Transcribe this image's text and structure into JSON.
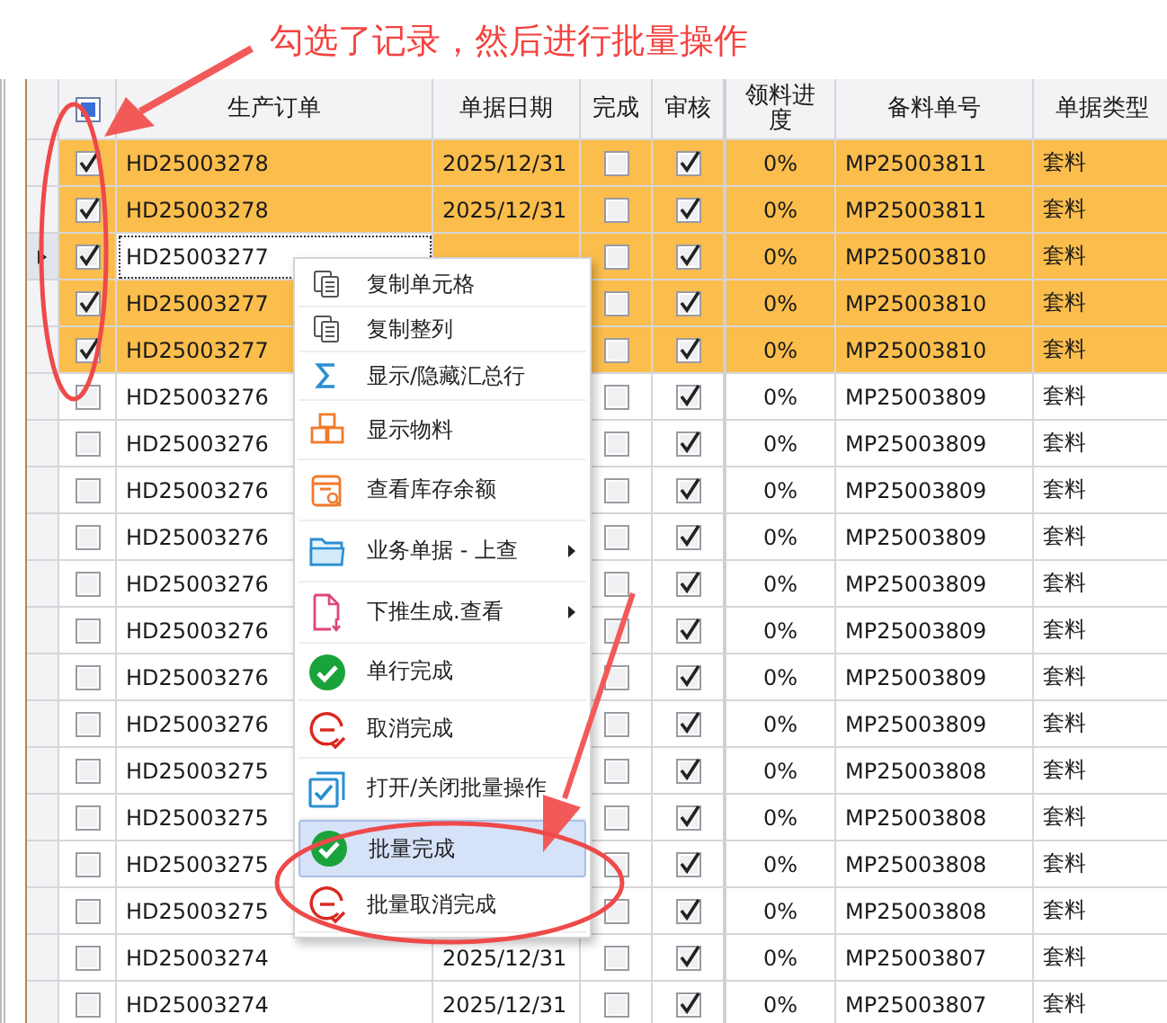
{
  "annotation": {
    "caption": "勾选了记录，然后进行批量操作"
  },
  "grid": {
    "select_all": {
      "indeterminate": true
    },
    "columns": [
      "生产订单",
      "单据日期",
      "完成",
      "审核",
      "领料进度",
      "备料单号",
      "单据类型"
    ],
    "rows": [
      {
        "checked": true,
        "selected": true,
        "current": false,
        "order": "HD25003278",
        "date": "2025/12/31",
        "done": false,
        "audited": true,
        "progress": "0%",
        "prep_no": "MP25003811",
        "type": "套料"
      },
      {
        "checked": true,
        "selected": true,
        "current": false,
        "order": "HD25003278",
        "date": "2025/12/31",
        "done": false,
        "audited": true,
        "progress": "0%",
        "prep_no": "MP25003811",
        "type": "套料"
      },
      {
        "checked": true,
        "selected": true,
        "current": true,
        "order": "HD25003277",
        "done": false,
        "audited": true,
        "progress": "0%",
        "prep_no": "MP25003810",
        "type": "套料"
      },
      {
        "checked": true,
        "selected": true,
        "current": false,
        "order": "HD25003277",
        "done": false,
        "audited": true,
        "progress": "0%",
        "prep_no": "MP25003810",
        "type": "套料"
      },
      {
        "checked": true,
        "selected": true,
        "current": false,
        "order": "HD25003277",
        "done": false,
        "audited": true,
        "progress": "0%",
        "prep_no": "MP25003810",
        "type": "套料"
      },
      {
        "checked": false,
        "selected": false,
        "current": false,
        "order": "HD25003276",
        "done": false,
        "audited": true,
        "progress": "0%",
        "prep_no": "MP25003809",
        "type": "套料"
      },
      {
        "checked": false,
        "selected": false,
        "current": false,
        "order": "HD25003276",
        "done": false,
        "audited": true,
        "progress": "0%",
        "prep_no": "MP25003809",
        "type": "套料"
      },
      {
        "checked": false,
        "selected": false,
        "current": false,
        "order": "HD25003276",
        "done": false,
        "audited": true,
        "progress": "0%",
        "prep_no": "MP25003809",
        "type": "套料"
      },
      {
        "checked": false,
        "selected": false,
        "current": false,
        "order": "HD25003276",
        "done": false,
        "audited": true,
        "progress": "0%",
        "prep_no": "MP25003809",
        "type": "套料"
      },
      {
        "checked": false,
        "selected": false,
        "current": false,
        "order": "HD25003276",
        "done": false,
        "audited": true,
        "progress": "0%",
        "prep_no": "MP25003809",
        "type": "套料"
      },
      {
        "checked": false,
        "selected": false,
        "current": false,
        "order": "HD25003276",
        "done": false,
        "audited": true,
        "progress": "0%",
        "prep_no": "MP25003809",
        "type": "套料"
      },
      {
        "checked": false,
        "selected": false,
        "current": false,
        "order": "HD25003276",
        "done": false,
        "audited": true,
        "progress": "0%",
        "prep_no": "MP25003809",
        "type": "套料"
      },
      {
        "checked": false,
        "selected": false,
        "current": false,
        "order": "HD25003276",
        "done": false,
        "audited": true,
        "progress": "0%",
        "prep_no": "MP25003809",
        "type": "套料"
      },
      {
        "checked": false,
        "selected": false,
        "current": false,
        "order": "HD25003275",
        "done": false,
        "audited": true,
        "progress": "0%",
        "prep_no": "MP25003808",
        "type": "套料"
      },
      {
        "checked": false,
        "selected": false,
        "current": false,
        "order": "HD25003275",
        "done": false,
        "audited": true,
        "progress": "0%",
        "prep_no": "MP25003808",
        "type": "套料"
      },
      {
        "checked": false,
        "selected": false,
        "current": false,
        "order": "HD25003275",
        "done": false,
        "audited": true,
        "progress": "0%",
        "prep_no": "MP25003808",
        "type": "套料"
      },
      {
        "checked": false,
        "selected": false,
        "current": false,
        "order": "HD25003275",
        "done": false,
        "audited": true,
        "progress": "0%",
        "prep_no": "MP25003808",
        "type": "套料"
      },
      {
        "checked": false,
        "selected": false,
        "current": false,
        "order": "HD25003274",
        "date": "2025/12/31",
        "done": false,
        "audited": true,
        "progress": "0%",
        "prep_no": "MP25003807",
        "type": "套料"
      },
      {
        "checked": false,
        "selected": false,
        "current": false,
        "order": "HD25003274",
        "date": "2025/12/31",
        "done": false,
        "audited": true,
        "progress": "0%",
        "prep_no": "MP25003807",
        "type": "套料"
      }
    ]
  },
  "context_menu": {
    "items": [
      {
        "label": "复制单元格",
        "kind": "copy",
        "submenu": false,
        "selected": false
      },
      {
        "label": "复制整列",
        "kind": "copy",
        "submenu": false,
        "selected": false
      },
      {
        "label": "显示/隐藏汇总行",
        "kind": "sum",
        "submenu": false,
        "selected": false
      },
      {
        "label": "显示物料",
        "kind": "boxes",
        "submenu": false,
        "selected": false
      },
      {
        "label": "查看库存余额",
        "kind": "stock",
        "submenu": false,
        "selected": false
      },
      {
        "label": "业务单据 - 上查",
        "kind": "folder",
        "submenu": true,
        "selected": false
      },
      {
        "label": "下推生成.查看",
        "kind": "document",
        "submenu": true,
        "selected": false
      },
      {
        "label": "单行完成",
        "kind": "complete",
        "submenu": false,
        "selected": false
      },
      {
        "label": "取消完成",
        "kind": "cancel",
        "submenu": false,
        "selected": false
      },
      {
        "label": "打开/关闭批量操作",
        "kind": "batch",
        "submenu": false,
        "selected": false
      },
      {
        "label": "批量完成",
        "kind": "complete",
        "submenu": false,
        "selected": true
      },
      {
        "label": "批量取消完成",
        "kind": "cancel",
        "submenu": false,
        "selected": false
      }
    ]
  }
}
